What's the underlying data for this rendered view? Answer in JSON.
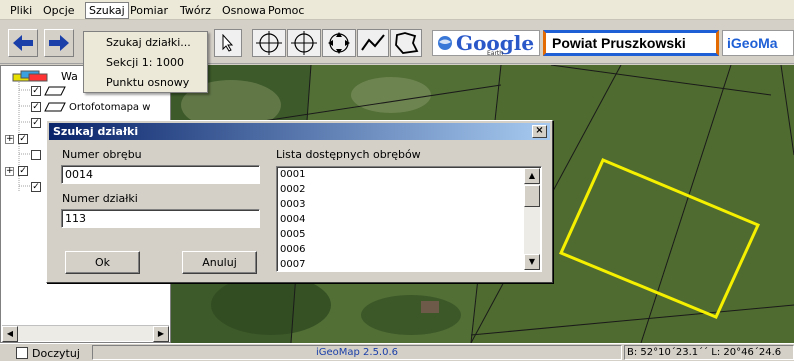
{
  "menu": {
    "items": [
      "Pliki",
      "Opcje",
      "Szukaj",
      "Pomiar",
      "Twórz",
      "Osnowa",
      "Pomoc"
    ]
  },
  "dropdown": {
    "items": [
      "Szukaj działki...",
      "Sekcji 1: 1000",
      "Punktu osnowy"
    ]
  },
  "toolbar": {
    "google_logo": "Google",
    "google_sub": "Earth",
    "powiat_label": "Powiat Pruszkowski",
    "igeomap_label": "iGeoMa"
  },
  "tree": {
    "items": [
      "Wa",
      "",
      "Ortofotomapa w",
      "",
      "",
      "",
      "",
      ""
    ]
  },
  "dialog": {
    "title": "Szukaj działki",
    "close_label": "×",
    "numer_obrebu_label": "Numer obrębu",
    "numer_obrebu_value": "0014",
    "numer_dzialki_label": "Numer działki",
    "numer_dzialki_value": "113",
    "lista_label": "Lista dostępnych obrębów",
    "lista_items": [
      "0001",
      "0002",
      "0003",
      "0004",
      "0005",
      "0006",
      "0007"
    ],
    "ok_label": "Ok",
    "cancel_label": "Anuluj"
  },
  "status": {
    "doczytuj_label": "Doczytuj",
    "version": "iGeoMap 2.5.0.6",
    "coords": "B: 52°10´23.1´´ L: 20°46´24.6"
  },
  "colors": {
    "parcel_outline": "#f5f000",
    "dialog_title_start": "#0a246a",
    "dialog_title_end": "#a6caf0",
    "powiat_border": "#1e5fd6"
  }
}
